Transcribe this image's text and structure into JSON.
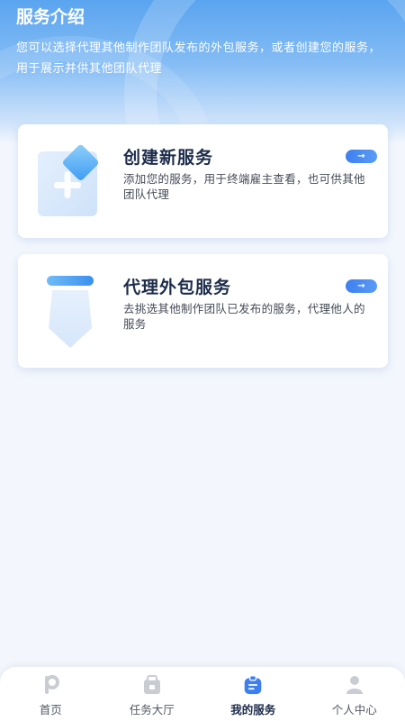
{
  "header": {
    "title": "服务介绍",
    "description": "您可以选择代理其他制作团队发布的外包服务，或者创建您的服务，用于展示并供其他团队代理"
  },
  "cards": [
    {
      "title": "创建新服务",
      "description": "添加您的服务，用于终端雇主查看，也可供其他团队代理",
      "icon": "create-service-icon",
      "arrow": "→"
    },
    {
      "title": "代理外包服务",
      "description": "去挑选其他制作团队已发布的服务，代理他人的服务",
      "icon": "agent-service-icon",
      "arrow": "→"
    }
  ],
  "tabbar": {
    "tabs": [
      {
        "label": "首页",
        "icon": "home-icon",
        "active": false
      },
      {
        "label": "任务大厅",
        "icon": "task-hall-icon",
        "active": false
      },
      {
        "label": "我的服务",
        "icon": "my-service-icon",
        "active": true
      },
      {
        "label": "个人中心",
        "icon": "profile-icon",
        "active": false
      }
    ]
  },
  "colors": {
    "accent": "#3d7ff0",
    "title": "#1c2c4a",
    "background": "#f3f7fd"
  }
}
